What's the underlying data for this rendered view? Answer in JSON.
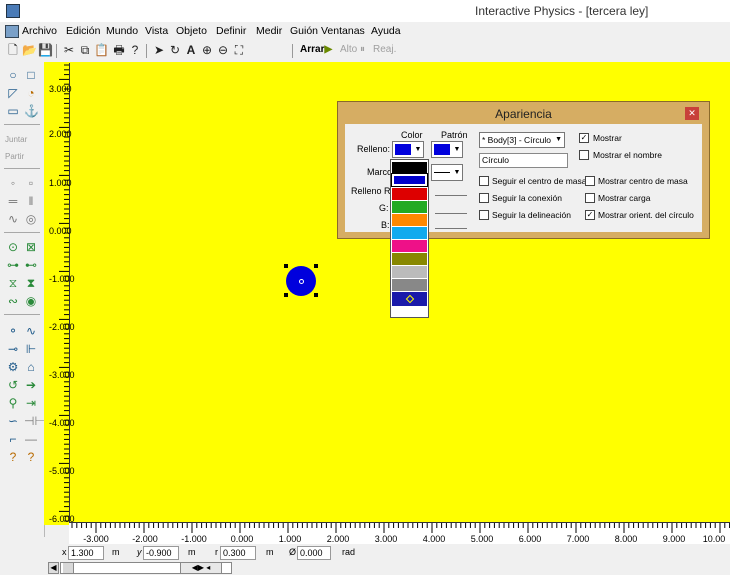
{
  "window": {
    "title": "Interactive Physics - [tercera ley]"
  },
  "menu": {
    "items": [
      {
        "label": "Archivo"
      },
      {
        "label": "Edición"
      },
      {
        "label": "Mundo"
      },
      {
        "label": "Vista"
      },
      {
        "label": "Objeto"
      },
      {
        "label": "Definir"
      },
      {
        "label": "Medir"
      },
      {
        "label": "Guión"
      },
      {
        "label": "Ventanas"
      },
      {
        "label": "Ayuda"
      }
    ]
  },
  "toolbar": {
    "run_label": "Arrar",
    "stop_label": "Alto",
    "reset_label": "Reaj."
  },
  "palette": {
    "join_label": "Juntar",
    "split_label": "Partir"
  },
  "workspace": {
    "background": "#ffff00",
    "y_ticks": [
      "3.000",
      "2.000",
      "1.000",
      "0.000",
      "-1.000",
      "-2.000",
      "-3.000",
      "-4.000",
      "-5.000",
      "-6.000"
    ],
    "x_ticks": [
      "-3.000",
      "-2.000",
      "-1.000",
      "0.000",
      "1.000",
      "2.000",
      "3.000",
      "4.000",
      "5.000",
      "6.000",
      "7.000",
      "8.000",
      "9.000",
      "10.00"
    ]
  },
  "body": {
    "shape": "circle",
    "color": "#0000dd"
  },
  "status": {
    "x_label": "x",
    "x_value": "1.300",
    "x_unit": "m",
    "y_label": "y",
    "y_value": "-0.900",
    "y_unit": "m",
    "r_label": "r",
    "r_value": "0.300",
    "r_unit": "m",
    "phi_label": "Ø",
    "phi_value": "0.000",
    "phi_unit": "rad"
  },
  "dialog": {
    "title": "Apariencia",
    "color_header": "Color",
    "pattern_header": "Patrón",
    "fill_label": "Relleno:",
    "frame_label": "Marco:",
    "fill_r_label": "Relleno  R:",
    "g_label": "G:",
    "b_label": "B:",
    "body_select": "* Body[3] - Círculo",
    "name_value": "Círculo",
    "fill_color": "#0000dd",
    "checkboxes": {
      "show": {
        "label": "Mostrar",
        "checked": true
      },
      "show_name": {
        "label": "Mostrar el nombre",
        "checked": false
      },
      "track_cm": {
        "label": "Seguir el centro de masa",
        "checked": false
      },
      "show_cm": {
        "label": "Mostrar centro de masa",
        "checked": false
      },
      "track_conn": {
        "label": "Seguir la conexión",
        "checked": false
      },
      "show_charge": {
        "label": "Mostrar carga",
        "checked": false
      },
      "track_outline": {
        "label": "Seguir la delineación",
        "checked": false
      },
      "show_orient": {
        "label": "Mostrar orient. del círculo",
        "checked": true
      }
    }
  },
  "color_popup": {
    "swatches": [
      "#000000",
      "#0000cc",
      "#dd0000",
      "#22aa22",
      "#ff8800",
      "#11aaee",
      "#ee1188",
      "#888800",
      "#bbbbbb",
      "#888888",
      "#1a1aaa"
    ]
  }
}
